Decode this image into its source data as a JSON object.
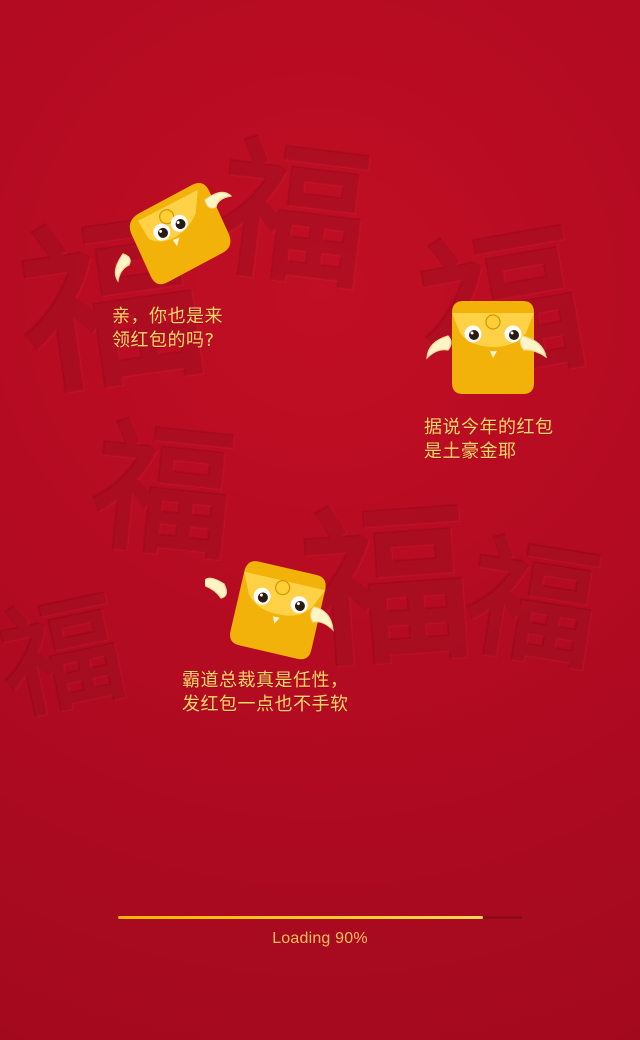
{
  "messages": [
    {
      "line1": "亲，你也是来",
      "line2": "领红包的吗?"
    },
    {
      "line1": "据说今年的红包",
      "line2": "是土豪金耶"
    },
    {
      "line1": "霸道总裁真是任性，",
      "line2": "发红包一点也不手软"
    }
  ],
  "loading": {
    "label": "Loading 90%",
    "progress": 0.9
  },
  "colors": {
    "background": "#b40b22",
    "accent": "#ffcd28",
    "caption": "#ffd86a"
  },
  "icons": {
    "mascot": "red-envelope-mascot-icon",
    "background_texture": "fu-character-pattern"
  }
}
